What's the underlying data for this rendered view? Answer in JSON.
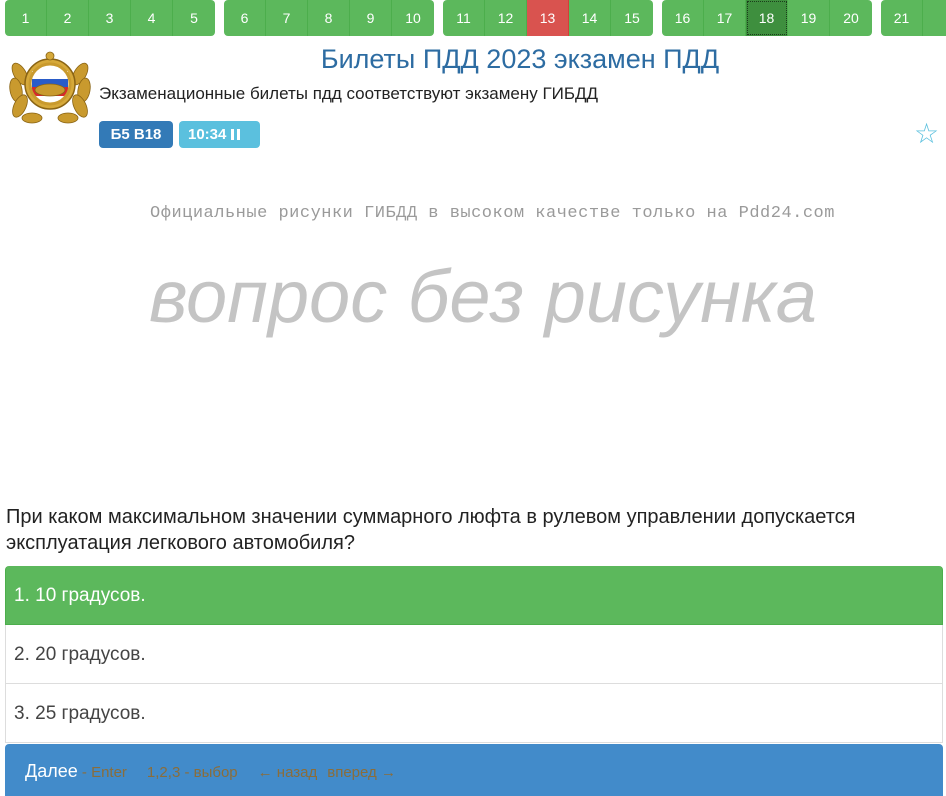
{
  "nav": {
    "questions": [
      "1",
      "2",
      "3",
      "4",
      "5",
      "6",
      "7",
      "8",
      "9",
      "10",
      "11",
      "12",
      "13",
      "14",
      "15",
      "16",
      "17",
      "18",
      "19",
      "20",
      "21"
    ],
    "wrong": "13",
    "current": "18"
  },
  "header": {
    "title": "Билеты ПДД 2023 экзамен ПДД",
    "subtitle": "Экзаменационные билеты пдд соответствуют экзамену ГИБДД",
    "ticket_badge": "Б5 В18",
    "timer": "10:34"
  },
  "picture": {
    "watermark": "Официальные рисунки ГИБДД в высоком качестве только на Pdd24.com",
    "placeholder": "вопрос без рисунка"
  },
  "question": {
    "text": "При каком максимальном значении суммарного люфта в рулевом управлении допускается эксплуатация легкового автомобиля?",
    "answers": [
      "1. 10 градусов.",
      "2. 20 градусов.",
      "3. 25 градусов."
    ]
  },
  "footer": {
    "next": "Далее",
    "next_hint": " - Enter",
    "choose_hint": "1,2,3 - выбор",
    "back": "← назад",
    "forward": "вперед →"
  },
  "colors": {
    "green": "#5cb85c",
    "red": "#d9534f",
    "blue": "#428bca",
    "title_blue": "#2d6ca2"
  },
  "icons": [
    "emblem-icon",
    "pause-icon",
    "star-icon"
  ]
}
